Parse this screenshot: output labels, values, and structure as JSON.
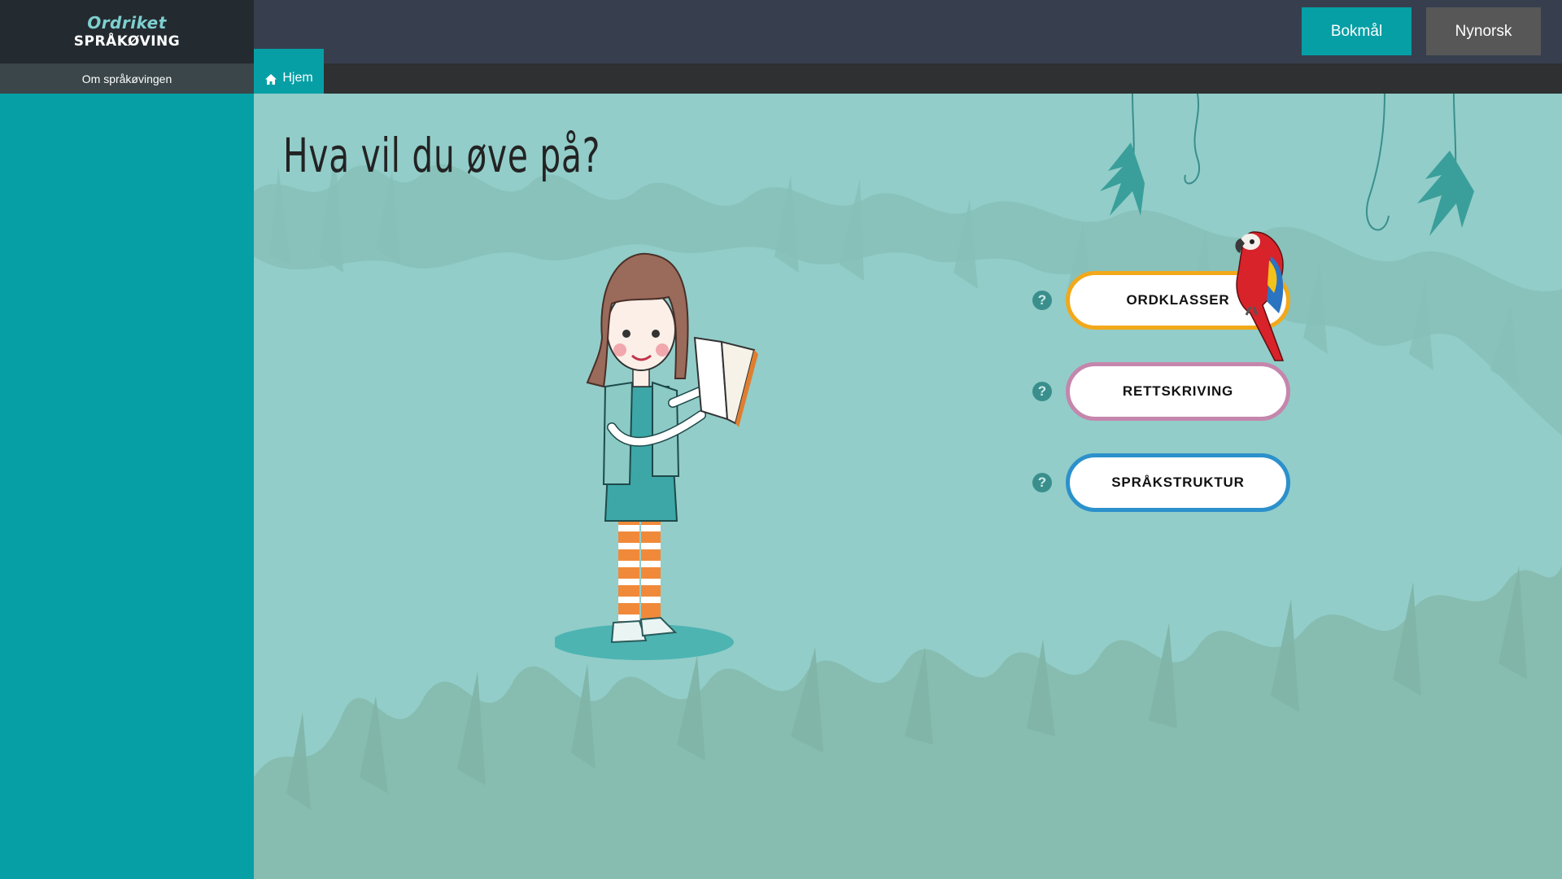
{
  "brand": {
    "logo": "Ordriket",
    "subtitle": "SPRÅKØVING"
  },
  "sidebar": {
    "about_link": "Om språkøvingen"
  },
  "nav": {
    "home_label": "Hjem"
  },
  "languages": {
    "bokmal": "Bokmål",
    "nynorsk": "Nynorsk",
    "active": "Bokmål"
  },
  "main": {
    "title": "Hva vil du øve på?",
    "choices": [
      {
        "label": "ORDKLASSER",
        "help": "?",
        "color": "#f2a81a"
      },
      {
        "label": "RETTSKRIVING",
        "help": "?",
        "color": "#c586ad"
      },
      {
        "label": "SPRÅKSTRUKTUR",
        "help": "?",
        "color": "#2c91cb"
      }
    ]
  },
  "colors": {
    "teal": "#069fa6",
    "topbar": "#373f4e",
    "background": "#92cdc9"
  }
}
